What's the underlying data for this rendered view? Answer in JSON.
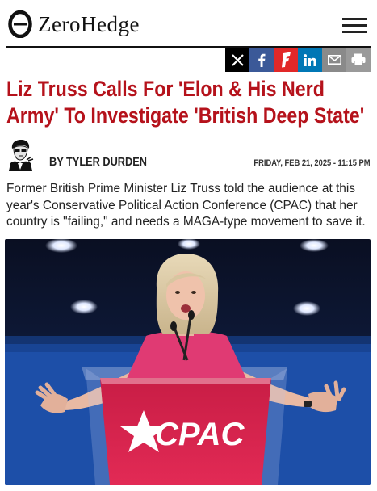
{
  "site": {
    "name": "ZeroHedge",
    "logo_icon": "zerohedge-logo-mark"
  },
  "header": {
    "menu_icon": "hamburger-menu-icon"
  },
  "share": {
    "buttons": [
      {
        "name": "x",
        "glyph": "𝕏"
      },
      {
        "name": "facebook",
        "glyph": "f"
      },
      {
        "name": "flipboard",
        "glyph": "f"
      },
      {
        "name": "linkedin",
        "glyph": "in"
      },
      {
        "name": "email",
        "glyph": "✉"
      },
      {
        "name": "print",
        "glyph": "⎙"
      }
    ]
  },
  "article": {
    "title": "Liz Truss Calls For 'Elon & His Nerd Army' To Investigate 'British Deep State'",
    "byline": "BY TYLER DURDEN",
    "date": "FRIDAY, FEB 21, 2025 - 11:15 PM",
    "lede": "Former British Prime Minister Liz Truss told the audience at this year's Conservative Political Action Conference (CPAC) that her country is \"failing,\" and needs a MAGA-type movement to save it.",
    "image": {
      "podium_text": "CPAC"
    }
  },
  "colors": {
    "headline": "#b5121b",
    "podium": "#d61f4a",
    "stage_blue": "#1d4fa8"
  }
}
